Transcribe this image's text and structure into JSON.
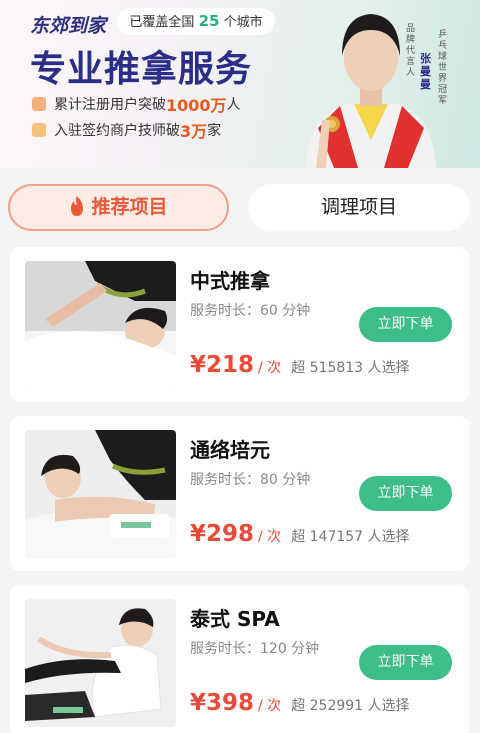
{
  "banner": {
    "brand": "东郊到家",
    "coverage_prefix": "已覆盖全国",
    "coverage_num": "25",
    "coverage_suffix": "个城市",
    "headline": "专业推拿服务",
    "stat1_prefix": "累计注册用户突破",
    "stat1_num": "1000万",
    "stat1_suffix": "人",
    "stat2_prefix": "入驻签约商户技师破",
    "stat2_num": "3万",
    "stat2_suffix": "家",
    "endorser_tag": "品牌代言人",
    "endorser_name": "张曼曼",
    "endorser_title": "乒乓球世界冠军"
  },
  "tabs": {
    "recommended": "推荐项目",
    "conditioning": "调理项目"
  },
  "services": [
    {
      "name": "中式推拿",
      "duration": "服务时长：60 分钟",
      "price": "¥218",
      "unit": "/ 次",
      "chosen": "超 515813 人选择",
      "order": "立即下单"
    },
    {
      "name": "通络培元",
      "duration": "服务时长：80 分钟",
      "price": "¥298",
      "unit": "/ 次",
      "chosen": "超 147157 人选择",
      "order": "立即下单"
    },
    {
      "name": "泰式 SPA",
      "duration": "服务时长：120 分钟",
      "price": "¥398",
      "unit": "/ 次",
      "chosen": "超 252991 人选择",
      "order": "立即下单"
    }
  ],
  "colors": {
    "accent_green": "#3dbd8a",
    "price_red": "#e84b3a",
    "headline_navy": "#2a2e86"
  }
}
